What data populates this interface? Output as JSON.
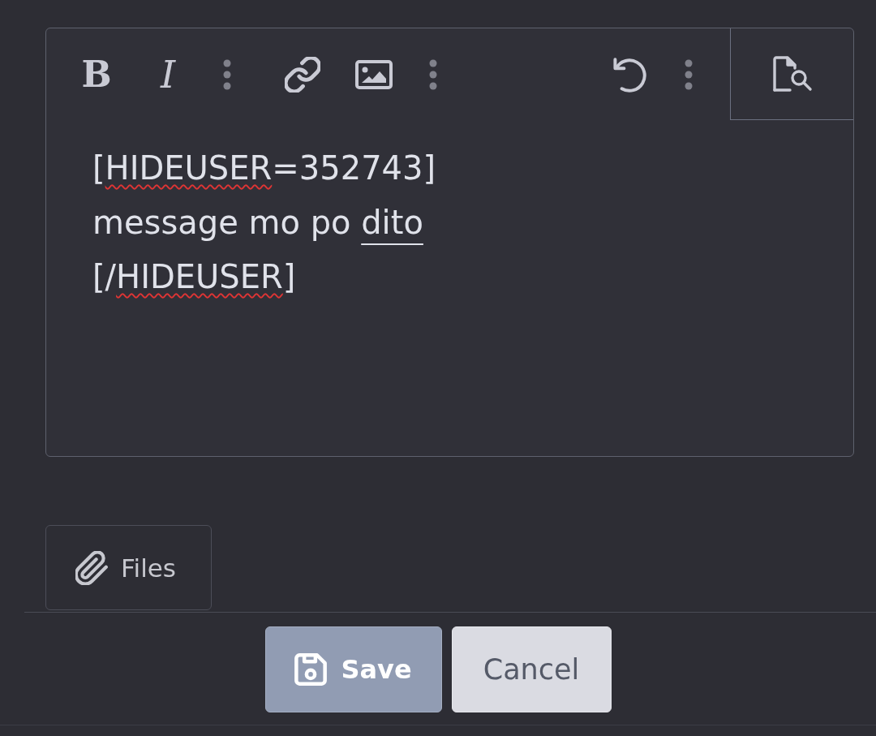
{
  "editor": {
    "toolbar": [
      {
        "kind": "bold",
        "label": "B"
      },
      {
        "kind": "italic",
        "label": "I"
      },
      {
        "kind": "more"
      },
      {
        "kind": "link"
      },
      {
        "kind": "image"
      },
      {
        "kind": "more"
      },
      {
        "kind": "undo"
      },
      {
        "kind": "more"
      },
      {
        "kind": "preview"
      }
    ],
    "lines": [
      {
        "runs": [
          {
            "kind": "plain",
            "text": "["
          },
          {
            "kind": "misspelled",
            "text": "HIDEUSER"
          },
          {
            "kind": "plain",
            "text": "=352743]"
          }
        ]
      },
      {
        "runs": [
          {
            "kind": "plain",
            "text": "message mo po "
          },
          {
            "kind": "underlined",
            "text": "dito"
          }
        ]
      },
      {
        "runs": [
          {
            "kind": "plain",
            "text": "[/"
          },
          {
            "kind": "misspelled",
            "text": "HIDEUSER"
          },
          {
            "kind": "plain",
            "text": "]"
          }
        ]
      }
    ]
  },
  "attach": {
    "label": "Files"
  },
  "actions": [
    {
      "kind": "primary",
      "label": "Save"
    },
    {
      "kind": "secondary",
      "label": "Cancel"
    }
  ]
}
